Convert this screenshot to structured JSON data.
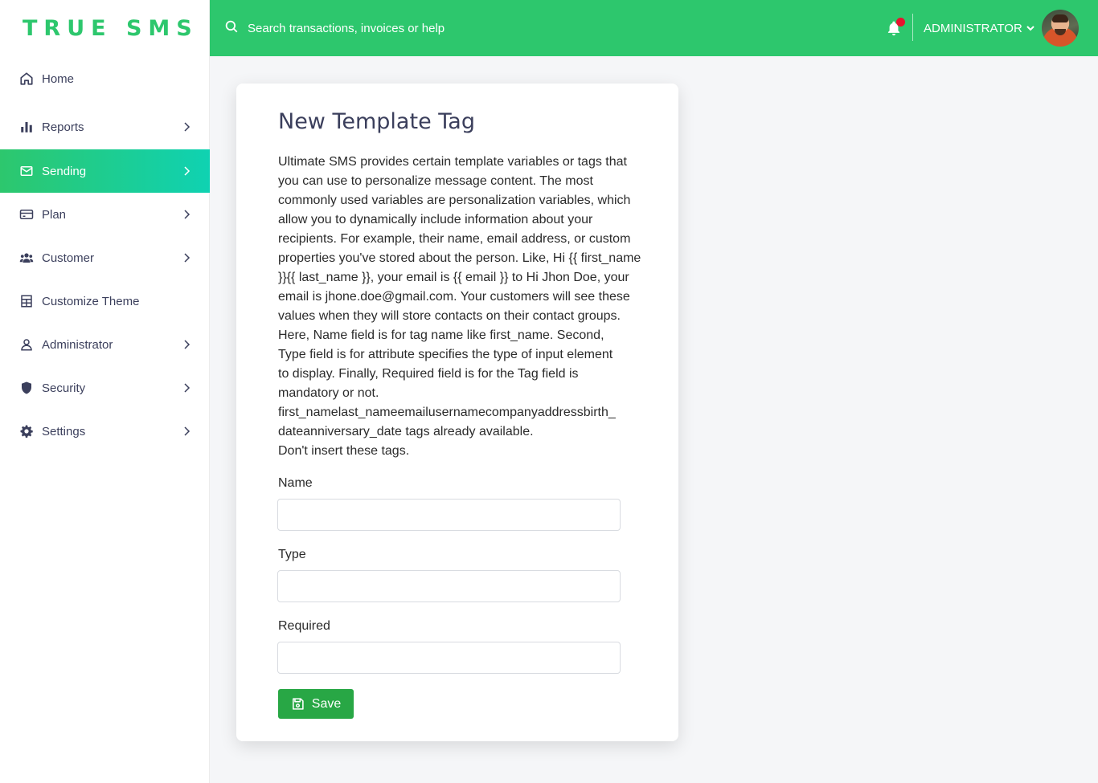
{
  "brand": {
    "name": "TRUE SMS",
    "color": "#2dc76d"
  },
  "sidebar": {
    "items": [
      {
        "label": "Home",
        "icon": "home-icon",
        "has_chevron": false,
        "active": false
      },
      {
        "label": "Reports",
        "icon": "bar-chart-icon",
        "has_chevron": true,
        "active": false
      },
      {
        "label": "Sending",
        "icon": "mail-icon",
        "has_chevron": true,
        "active": true
      },
      {
        "label": "Plan",
        "icon": "credit-card-icon",
        "has_chevron": true,
        "active": false
      },
      {
        "label": "Customer",
        "icon": "users-icon",
        "has_chevron": true,
        "active": false
      },
      {
        "label": "Customize Theme",
        "icon": "grid-icon",
        "has_chevron": false,
        "active": false
      },
      {
        "label": "Administrator",
        "icon": "user-icon",
        "has_chevron": true,
        "active": false
      },
      {
        "label": "Security",
        "icon": "shield-icon",
        "has_chevron": true,
        "active": false
      },
      {
        "label": "Settings",
        "icon": "gear-icon",
        "has_chevron": true,
        "active": false
      }
    ]
  },
  "topbar": {
    "search_placeholder": "Search transactions, invoices or help",
    "user_label": "ADMINISTRATOR",
    "notification_dot_color": "#e8132f",
    "bar_color": "#2dc76d"
  },
  "form": {
    "title": "New Template Tag",
    "description_lines": [
      "Ultimate SMS provides certain template variables or tags that",
      "you can use to personalize message content. The most",
      "commonly used variables are personalization variables, which",
      "allow you to dynamically include information about your",
      "recipients. For example, their name, email address, or custom",
      "properties you've stored about the person. Like, Hi {{ first_name",
      "}}{{ last_name }}, your email is {{ email }} to Hi Jhon Doe, your",
      "email is jhone.doe@gmail.com. Your customers will see these",
      "values when they will store contacts on their contact groups.",
      "Here, Name field is for tag name like first_name. Second,",
      "Type field is for attribute specifies the type of input element",
      "to display. Finally, Required field is for the Tag field is",
      "mandatory or not.",
      "first_namelast_nameemailusernamecompanyaddressbirth_",
      "dateanniversary_date tags already available.",
      "Don't insert these tags."
    ],
    "fields": {
      "name": {
        "label": "Name",
        "value": ""
      },
      "type": {
        "label": "Type",
        "value": ""
      },
      "required": {
        "label": "Required",
        "value": ""
      }
    },
    "save_label": "Save",
    "save_color": "#28a745"
  }
}
